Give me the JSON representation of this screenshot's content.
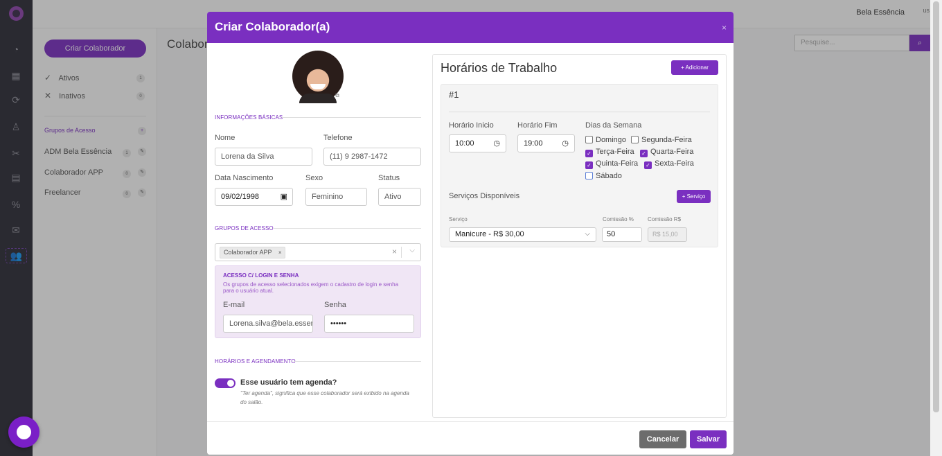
{
  "topbar": {
    "user_name": "Bela Essência",
    "avatar_alt": "us"
  },
  "sidebar_left": {
    "create_button": "Criar Colaborador",
    "active": {
      "label": "Ativos",
      "count": "1"
    },
    "inactive": {
      "label": "Inativos",
      "count": "0"
    },
    "groups_header": "Grupos de Acesso",
    "groups": [
      {
        "label": "ADM Bela Essência",
        "count": "1"
      },
      {
        "label": "Colaborador APP",
        "count": "0"
      },
      {
        "label": "Freelancer",
        "count": "0"
      }
    ]
  },
  "main": {
    "title": "Colabor",
    "search_placeholder": "Pesquise..."
  },
  "modal": {
    "title": "Criar Colaborador(a)",
    "close": "×",
    "sections": {
      "basic": "INFORMAÇÕES BÁSICAS",
      "groups": "GRUPOS DE ACESSO",
      "schedule": "HORÁRIOS E AGENDAMENTO"
    },
    "fields": {
      "name_label": "Nome",
      "name_value": "Lorena da Silva",
      "phone_label": "Telefone",
      "phone_value": "(11) 9 2987-1472",
      "birth_label": "Data Nascimento",
      "birth_value": "09/02/1998",
      "sex_label": "Sexo",
      "sex_value": "Feminino",
      "status_label": "Status",
      "status_value": "Ativo"
    },
    "group_tag": "Colaborador APP",
    "login": {
      "title": "ACESSO C/ LOGIN E SENHA",
      "desc": "Os grupos de acesso selecionados exigem o cadastro de login e senha para o usuário atual.",
      "email_label": "E-mail",
      "email_value": "Lorena.silva@bela.essencia",
      "password_label": "Senha",
      "password_value": "••••••"
    },
    "agenda": {
      "label": "Esse usuário tem agenda?",
      "note": "\"Ter agenda\", significa que esse colaborador será exibido na agenda do salão."
    },
    "schedule": {
      "title": "Horários de Trabalho",
      "add_button": "+ Adicionar",
      "card_number": "#1",
      "start_label": "Horário Inicio",
      "start_value": "10:00",
      "end_label": "Horário Fim",
      "end_value": "19:00",
      "days_label": "Dias da Semana",
      "days": {
        "domingo": "Domingo",
        "segunda": "Segunda-Feira",
        "terca": "Terça-Feira",
        "quarta": "Quarta-Feira",
        "quinta": "Quinta-Feira",
        "sexta": "Sexta-Feira",
        "sabado": "Sábado"
      },
      "days_checked": {
        "domingo": false,
        "segunda": false,
        "terca": true,
        "quarta": true,
        "quinta": true,
        "sexta": true,
        "sabado": false
      },
      "services_label": "Serviços Disponíveis",
      "service_button": "+ Serviço",
      "service_col": "Serviço",
      "commission_pct_col": "Comissão %",
      "commission_rs_col": "Comissão R$",
      "service_value": "Manicure - R$ 30,00",
      "commission_pct_value": "50",
      "commission_rs_value": "R$ 15,00"
    },
    "cancel_button": "Cancelar",
    "save_button": "Salvar"
  },
  "colors": {
    "accent": "#7a2fc0",
    "rail": "#2c2c36"
  }
}
